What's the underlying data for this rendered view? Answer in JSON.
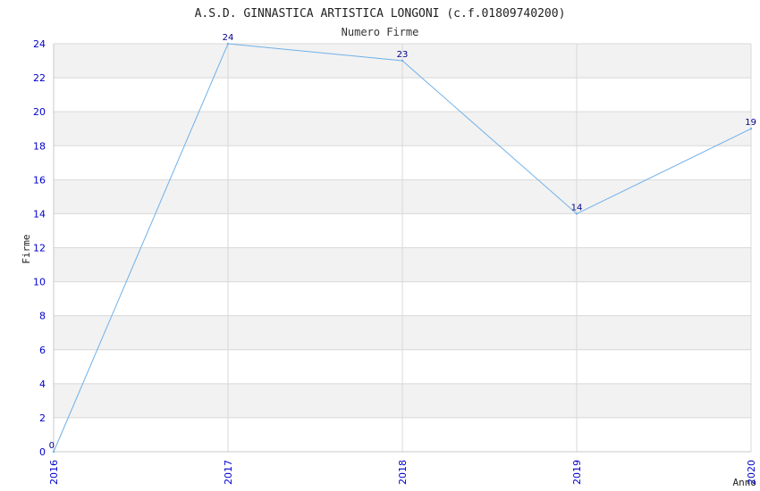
{
  "colors": {
    "band": "#f2f2f2",
    "grid": "#d8d8d8",
    "axis": "#c8c8c8",
    "line": "#6fb0e8",
    "tick_text": "#0000cc",
    "label_text": "#00008b"
  },
  "chart_data": {
    "type": "line",
    "title": "A.S.D. GINNASTICA ARTISTICA LONGONI (c.f.01809740200)",
    "subtitle": "Numero Firme",
    "xlabel": "Anno",
    "ylabel": "Firme",
    "categories": [
      "2016",
      "2017",
      "2018",
      "2019",
      "2020"
    ],
    "series": [
      {
        "values": [
          0,
          24,
          23,
          14,
          19
        ]
      }
    ],
    "ylim": [
      0,
      24
    ],
    "yticks": [
      0,
      2,
      4,
      6,
      8,
      10,
      12,
      14,
      16,
      18,
      20,
      22,
      24
    ],
    "grid": true,
    "banded_background": true
  }
}
